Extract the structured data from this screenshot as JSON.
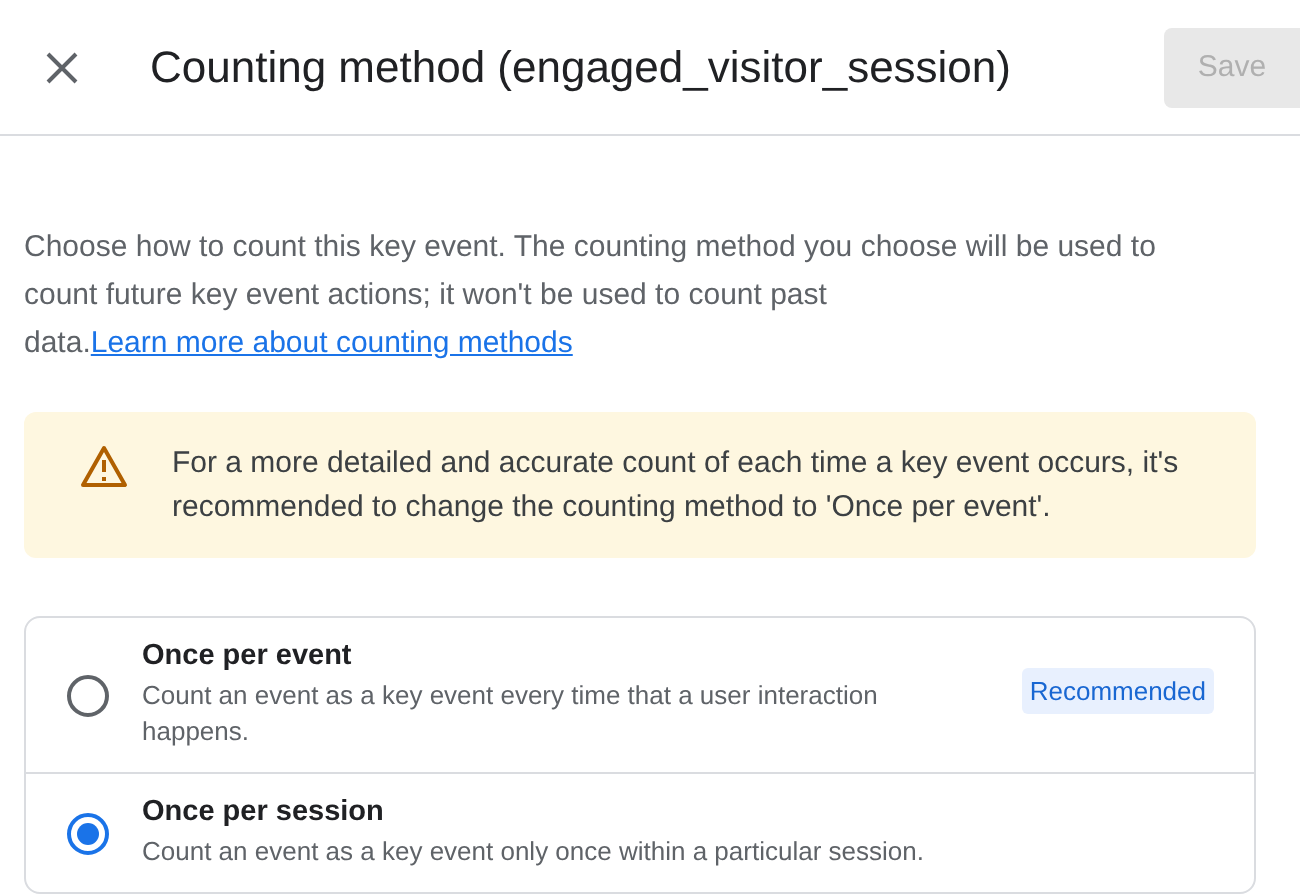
{
  "header": {
    "title": "Counting method (engaged_visitor_session)",
    "save_button": {
      "label": "Save",
      "disabled": true
    }
  },
  "description": {
    "text": "Choose how to count this key event. The counting method you choose will be used to count future key event actions; it won't be used to count past data.",
    "link": "Learn more about counting methods"
  },
  "warning": {
    "text": "For a more detailed and accurate count of each time a key event occurs, it's recommended to change the counting method to 'Once per event'."
  },
  "options": [
    {
      "title": "Once per event",
      "description": "Count an event as a key event every time that a user interaction happens.",
      "badge": "Recommended",
      "selected": false
    },
    {
      "title": "Once per session",
      "description": "Count an event as a key event only once within a particular session.",
      "selected": true
    }
  ]
}
